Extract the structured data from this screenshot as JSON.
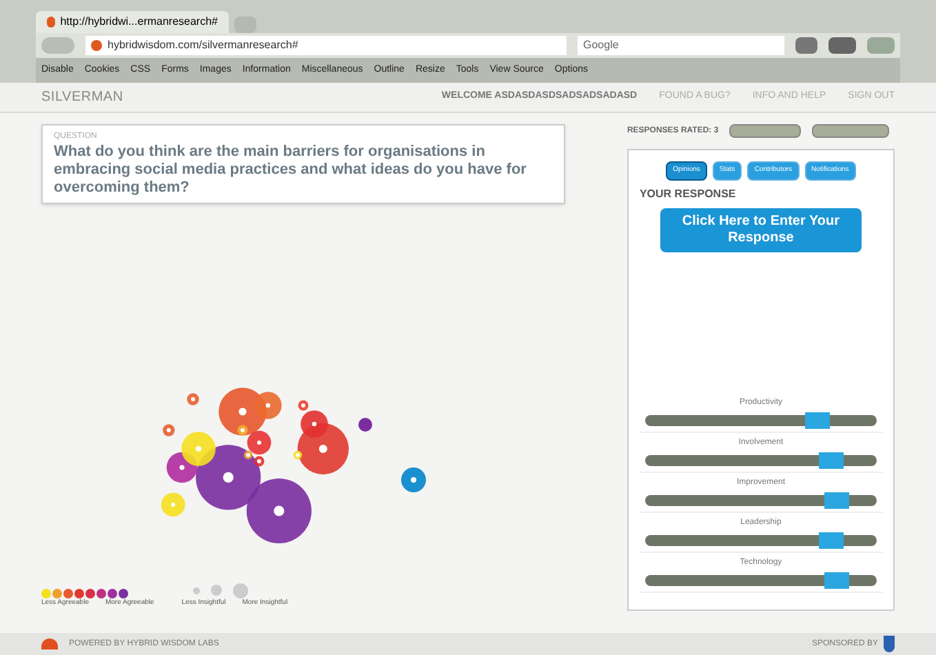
{
  "browser": {
    "tab_title": "http://hybridwi...ermanresearch#",
    "url": "hybridwisdom.com/silvermanresearch#",
    "search": "Google",
    "bookmarks": [
      "Disable",
      "Cookies",
      "CSS",
      "Forms",
      "Images",
      "Information",
      "Miscellaneous",
      "Outline",
      "Resize",
      "Tools",
      "View Source",
      "Options"
    ]
  },
  "header": {
    "logo": "SILVERMAN",
    "welcome": "WELCOME ASDASDASDSADSADSADASD",
    "links": [
      "FOUND A BUG?",
      "INFO AND HELP",
      "SIGN OUT"
    ]
  },
  "question": {
    "label": "QUESTION",
    "text": "What do you think are the main barriers for organisations in embracing social media practices and what ideas do you have for overcoming them?"
  },
  "responses_rated": "RESPONSES RATED: 3",
  "panel": {
    "tabs": [
      {
        "label": "Opinions",
        "selected": true
      },
      {
        "label": "Stats",
        "selected": false
      },
      {
        "label": "Contributors",
        "selected": false
      },
      {
        "label": "Notifications",
        "selected": false
      }
    ],
    "heading": "YOUR RESPONSE",
    "button": "Click Here to Enter Your Response",
    "sliders": [
      {
        "label": "Productivity",
        "level": 0.8
      },
      {
        "label": "Involvement",
        "level": 0.86
      },
      {
        "label": "Improvement",
        "level": 0.88
      },
      {
        "label": "Leadership",
        "level": 0.86
      },
      {
        "label": "Technology",
        "level": 0.88
      }
    ]
  },
  "legend": {
    "agreeable_scale": [
      {
        "color": "#f5e020"
      },
      {
        "color": "#f0a030"
      },
      {
        "color": "#e85a30"
      },
      {
        "color": "#e03a30"
      },
      {
        "color": "#d83048"
      },
      {
        "color": "#c03080"
      },
      {
        "color": "#a030a0"
      },
      {
        "color": "#7a30a0"
      }
    ],
    "labels": [
      "Less Agreeable",
      "More Agreeable",
      "Less Insightful",
      "More Insightful"
    ]
  },
  "footer": {
    "powered": "POWERED BY HYBRID WISDOM LABS",
    "sponsored": "SPONSORED BY"
  }
}
